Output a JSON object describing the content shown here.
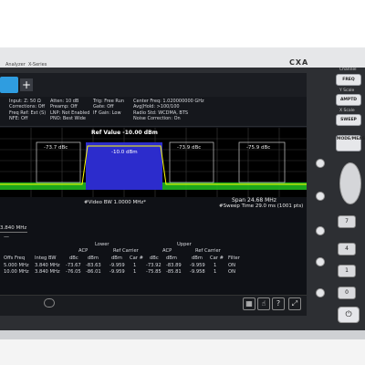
{
  "header": {
    "brand": "Analyzer",
    "model_line": "X-Series",
    "model": "CXA"
  },
  "tabs": {
    "add_label": "+"
  },
  "info_columns": [
    [
      "Input: Z: 50 Ω",
      "Corrections: Off",
      "Freq Ref: Ext (S)",
      "NFE: Off"
    ],
    [
      "Atten: 10 dB",
      "Preamp: Off",
      "LNP: Not Enabled",
      "PNO: Best Wide"
    ],
    [
      "Trig: Free Run",
      "Gate: Off",
      "IF Gain: Low"
    ],
    [
      "Center Freq: 1.020000000 GHz",
      "Avg|Hold: >100/100",
      "Radio Std: WCDMA, BTS",
      "Noise Correction: On"
    ]
  ],
  "plot": {
    "ref_value": "Ref Value -10.00 dBm",
    "left_dbc": "-73.7 dBc",
    "center_dbm": "-10.0 dBm",
    "right_dbc": "-73.9 dBc",
    "far_right_dbc": "-75.9 dBc",
    "vbw": "#Video BW 1.0000 MHz*",
    "span": "Span 24.68 MHz",
    "sweep": "#Sweep Time 29.0 ms (1001 pts)"
  },
  "table": {
    "freq_label": "3.840 MHz",
    "freq_dash": "—",
    "group_headers": {
      "lower": "Lower",
      "upper": "Upper"
    },
    "sub_headers": {
      "acp_lower": "ACP",
      "ref_carrier_lower": "Ref Carrier",
      "acp_upper": "ACP",
      "ref_carrier_upper": "Ref Carrier"
    },
    "columns": [
      "Offs Freq",
      "Integ BW",
      "dBc",
      "dBm",
      "dBm",
      "Car #",
      "dBc",
      "dBm",
      "dBm",
      "Car #",
      "Filter"
    ],
    "rows": [
      [
        "5.000 MHz",
        "3.840 MHz",
        "-73.67",
        "-83.63",
        "-9.959",
        "1",
        "-73.92",
        "-83.89",
        "-9.959",
        "1",
        "ON"
      ],
      [
        "10.00 MHz",
        "3.840 MHz",
        "-76.05",
        "-86.01",
        "-9.959",
        "1",
        "-75.85",
        "-85.81",
        "-9.958",
        "1",
        "ON"
      ]
    ]
  },
  "hardkeys": {
    "channel_label": "Channel",
    "freq": "FREQ",
    "y_scale_label": "Y Scale",
    "ampt": "AMPTD",
    "x_scale_label": "X Scale",
    "sweep": "SWEEP",
    "mode": "MODE/MEAS",
    "numbers": [
      "7",
      "4",
      "1",
      "0"
    ],
    "power": "⏻"
  },
  "colors": {
    "accent": "#2f9de0",
    "channel_fill": "#2c2ccc",
    "trace": "#ffff00",
    "noise": "#21c321"
  }
}
